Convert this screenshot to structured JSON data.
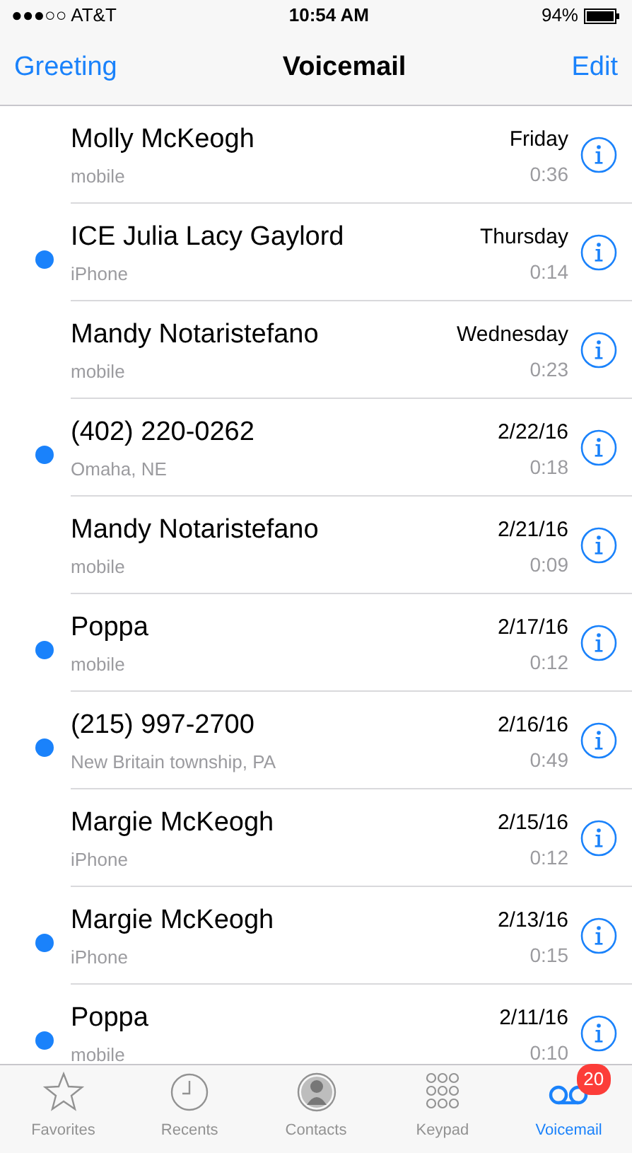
{
  "status_bar": {
    "carrier": "●●●○○ AT&T",
    "time": "10:54 AM",
    "battery": "94%"
  },
  "nav": {
    "left": "Greeting",
    "title": "Voicemail",
    "right": "Edit"
  },
  "voicemails": [
    {
      "name": "Molly McKeogh",
      "label": "mobile",
      "date": "Friday",
      "duration": "0:36",
      "unread": false
    },
    {
      "name": "ICE Julia Lacy Gaylord",
      "label": "iPhone",
      "date": "Thursday",
      "duration": "0:14",
      "unread": true
    },
    {
      "name": "Mandy Notaristefano",
      "label": "mobile",
      "date": "Wednesday",
      "duration": "0:23",
      "unread": false
    },
    {
      "name": "(402) 220-0262",
      "label": "Omaha, NE",
      "date": "2/22/16",
      "duration": "0:18",
      "unread": true
    },
    {
      "name": "Mandy Notaristefano",
      "label": "mobile",
      "date": "2/21/16",
      "duration": "0:09",
      "unread": false
    },
    {
      "name": "Poppa",
      "label": "mobile",
      "date": "2/17/16",
      "duration": "0:12",
      "unread": true
    },
    {
      "name": "(215) 997-2700",
      "label": "New Britain township, PA",
      "date": "2/16/16",
      "duration": "0:49",
      "unread": true
    },
    {
      "name": "Margie McKeogh",
      "label": "iPhone",
      "date": "2/15/16",
      "duration": "0:12",
      "unread": false
    },
    {
      "name": "Margie McKeogh",
      "label": "iPhone",
      "date": "2/13/16",
      "duration": "0:15",
      "unread": true
    },
    {
      "name": "Poppa",
      "label": "mobile",
      "date": "2/11/16",
      "duration": "0:10",
      "unread": true
    }
  ],
  "tabs": [
    {
      "kind": "star",
      "label": "Favorites",
      "selected": false
    },
    {
      "kind": "clock",
      "label": "Recents",
      "selected": false
    },
    {
      "kind": "person",
      "label": "Contacts",
      "selected": false
    },
    {
      "kind": "keypad",
      "label": "Keypad",
      "selected": false
    },
    {
      "kind": "voicemail",
      "label": "Voicemail",
      "selected": true,
      "badge": "20"
    }
  ]
}
